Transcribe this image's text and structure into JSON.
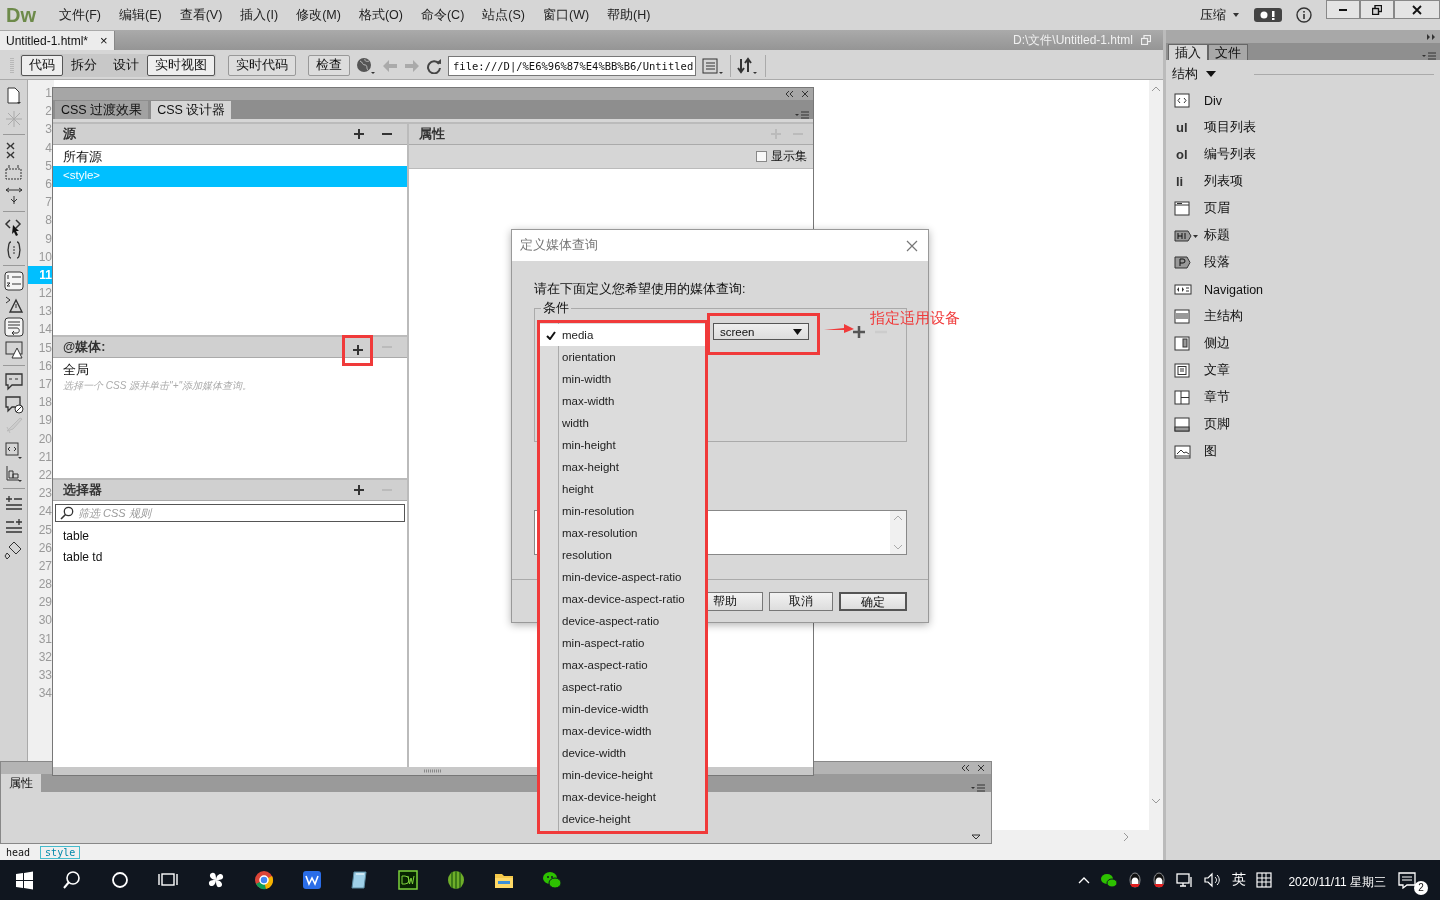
{
  "app": {
    "logo": "Dw",
    "menus": [
      "文件(F)",
      "编辑(E)",
      "查看(V)",
      "插入(I)",
      "修改(M)",
      "格式(O)",
      "命令(C)",
      "站点(S)",
      "窗口(W)",
      "帮助(H)"
    ],
    "layout_menu": "压缩"
  },
  "document": {
    "tab": {
      "title": "Untitled-1.html*",
      "close": "×"
    },
    "path": "D:\\文件\\Untitled-1.html"
  },
  "toolbar": {
    "view_buttons": [
      "代码",
      "拆分",
      "设计",
      "实时视图"
    ],
    "buttons": [
      "实时代码",
      "检查"
    ],
    "address": "file:///D|/%E6%96%87%E4%BB%B6/Untitled"
  },
  "code": {
    "lines": [
      {
        "number": "1",
        "selected": false
      },
      {
        "number": "2",
        "selected": false
      },
      {
        "number": "3",
        "selected": false
      },
      {
        "number": "4",
        "selected": false
      },
      {
        "number": "5",
        "selected": false
      },
      {
        "number": "6",
        "selected": false
      },
      {
        "number": "7",
        "selected": false
      },
      {
        "number": "8",
        "selected": false
      },
      {
        "number": "9",
        "selected": false
      },
      {
        "number": "10",
        "selected": false
      },
      {
        "number": "11",
        "selected": true
      },
      {
        "number": "12",
        "selected": false
      },
      {
        "number": "13",
        "selected": false
      },
      {
        "number": "14",
        "selected": false
      },
      {
        "number": "15",
        "selected": false
      },
      {
        "number": "16",
        "selected": false
      },
      {
        "number": "17",
        "selected": false
      },
      {
        "number": "18",
        "selected": false
      },
      {
        "number": "19",
        "selected": false
      },
      {
        "number": "20",
        "selected": false
      },
      {
        "number": "21",
        "selected": false
      },
      {
        "number": "22",
        "selected": false
      },
      {
        "number": "23",
        "selected": false
      },
      {
        "number": "24",
        "selected": false
      },
      {
        "number": "25",
        "selected": false
      },
      {
        "number": "26",
        "selected": false
      },
      {
        "number": "27",
        "selected": false
      },
      {
        "number": "28",
        "selected": false
      },
      {
        "number": "29",
        "selected": false
      },
      {
        "number": "30",
        "selected": false
      },
      {
        "number": "31",
        "selected": false
      },
      {
        "number": "32",
        "selected": false
      },
      {
        "number": "33",
        "selected": false
      },
      {
        "number": "34",
        "selected": false
      }
    ]
  },
  "css_designer": {
    "tabs": [
      {
        "label": "CSS 过渡效果",
        "selected": false
      },
      {
        "label": "CSS 设计器",
        "selected": true
      }
    ],
    "sources": {
      "title": "源",
      "items": [
        {
          "label": "所有源",
          "selected": false
        },
        {
          "label": "<style>",
          "selected": true
        }
      ]
    },
    "media": {
      "title": "@媒体:",
      "items": [
        "全局"
      ],
      "hint": "选择一个 CSS 源并单击\"+\"添加媒体查询。"
    },
    "selectors": {
      "title": "选择器",
      "filter": {
        "placeholder": "筛选 CSS 规则"
      },
      "items": [
        "table",
        "table td"
      ]
    },
    "properties": {
      "title": "属性",
      "show_set": {
        "label": "显示集",
        "checked": false
      }
    }
  },
  "dialog": {
    "title": "定义媒体查询",
    "prompt": "请在下面定义您希望使用的媒体查询:",
    "group": "条件",
    "condition_value": "screen",
    "buttons": [
      "帮助",
      "取消",
      "确定"
    ]
  },
  "dropdown": {
    "options": [
      {
        "label": "media",
        "checked": true,
        "selected": true
      },
      {
        "label": "orientation",
        "checked": false
      },
      {
        "label": "min-width",
        "checked": false
      },
      {
        "label": "max-width",
        "checked": false
      },
      {
        "label": "width",
        "checked": false
      },
      {
        "label": "min-height",
        "checked": false
      },
      {
        "label": "max-height",
        "checked": false
      },
      {
        "label": "height",
        "checked": false
      },
      {
        "label": "min-resolution",
        "checked": false
      },
      {
        "label": "max-resolution",
        "checked": false
      },
      {
        "label": "resolution",
        "checked": false
      },
      {
        "label": "min-device-aspect-ratio",
        "checked": false
      },
      {
        "label": "max-device-aspect-ratio",
        "checked": false
      },
      {
        "label": "device-aspect-ratio",
        "checked": false
      },
      {
        "label": "min-aspect-ratio",
        "checked": false
      },
      {
        "label": "max-aspect-ratio",
        "checked": false
      },
      {
        "label": "aspect-ratio",
        "checked": false
      },
      {
        "label": "min-device-width",
        "checked": false
      },
      {
        "label": "max-device-width",
        "checked": false
      },
      {
        "label": "device-width",
        "checked": false
      },
      {
        "label": "min-device-height",
        "checked": false
      },
      {
        "label": "max-device-height",
        "checked": false
      },
      {
        "label": "device-height",
        "checked": false
      }
    ]
  },
  "annotation": {
    "label": "指定适用设备"
  },
  "insert_panel": {
    "tabs": [
      {
        "label": "插入",
        "selected": true
      },
      {
        "label": "文件",
        "selected": false
      }
    ],
    "category": "结构",
    "items": [
      {
        "label": "Div"
      },
      {
        "glyph": "ul",
        "label": "项目列表"
      },
      {
        "glyph": "ol",
        "label": "编号列表"
      },
      {
        "glyph": "li",
        "label": "列表项"
      },
      {
        "label": "页眉"
      },
      {
        "label": "标题"
      },
      {
        "label": "段落"
      },
      {
        "label": "Navigation"
      },
      {
        "label": "主结构"
      },
      {
        "label": "侧边"
      },
      {
        "label": "文章"
      },
      {
        "label": "章节"
      },
      {
        "label": "页脚"
      },
      {
        "label": "图"
      }
    ]
  },
  "properties_panel": {
    "title": "属性"
  },
  "tag_selector": [
    "head",
    "style"
  ],
  "taskbar": {
    "ime": "英",
    "date": "2020/11/11 星期三",
    "notifications": "2"
  }
}
